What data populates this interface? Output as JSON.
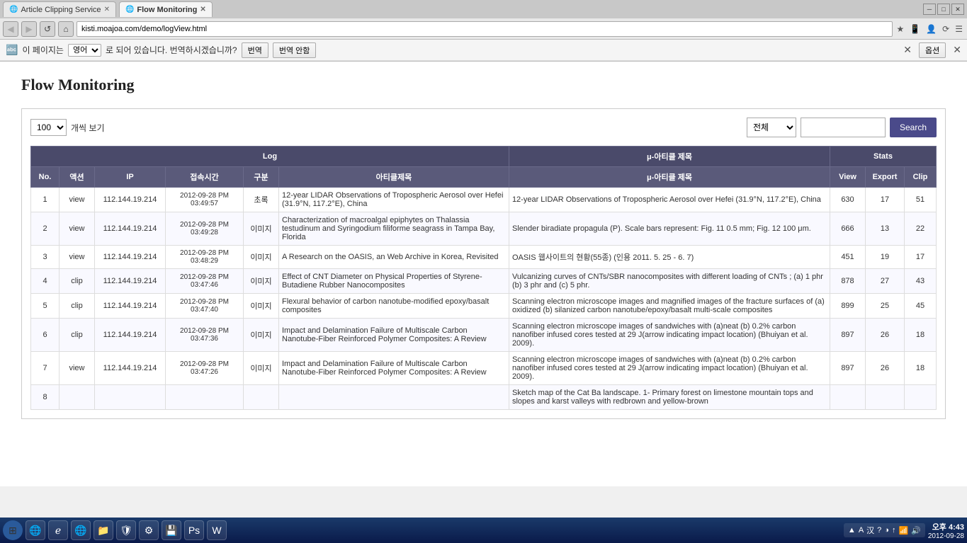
{
  "browser": {
    "tabs": [
      {
        "label": "Article Clipping Service",
        "active": false,
        "icon": "🌐"
      },
      {
        "label": "Flow Monitoring",
        "active": true,
        "icon": "🌐"
      }
    ],
    "url": "kisti.moajoa.com/demo/logView.html",
    "window_controls": [
      "─",
      "□",
      "✕"
    ]
  },
  "translate_bar": {
    "icon": "A",
    "text1": "이 페이지는",
    "lang_select": "영어",
    "text2": "로 되어 있습니다. 번역하시겠습니까?",
    "btn_translate": "번역",
    "btn_no_translate": "번역 안함",
    "btn_options": "옵션",
    "close": "✕"
  },
  "page": {
    "title": "Flow Monitoring"
  },
  "toolbar": {
    "per_page": "100",
    "per_page_label": "개씩 보기",
    "filter_option": "전체",
    "search_placeholder": "",
    "search_btn": "Search"
  },
  "table": {
    "section_log": "Log",
    "section_stats": "Stats",
    "headers": [
      "No.",
      "액션",
      "IP",
      "접속시간",
      "구분",
      "아티클제목",
      "μ-아티클 제목",
      "View",
      "Export",
      "Clip"
    ],
    "rows": [
      {
        "no": "1",
        "action": "view",
        "ip": "112.144.19.214",
        "time": "2012-09-28 PM\n03:49:57",
        "type": "초록",
        "article": "12-year LIDAR Observations of Tropospheric Aerosol over Hefei (31.9°N, 117.2°E), China",
        "micro": "12-year LIDAR Observations of Tropospheric Aerosol over Hefei (31.9°N, 117.2°E), China",
        "view": "630",
        "export": "17",
        "clip": "51"
      },
      {
        "no": "2",
        "action": "view",
        "ip": "112.144.19.214",
        "time": "2012-09-28 PM\n03:49:28",
        "type": "이미지",
        "article": "Characterization of macroalgal epiphytes on Thalassia testudinum and Syringodium filiforme seagrass in Tampa Bay, Florida",
        "micro": "Slender biradiate propagula (P). Scale bars represent: Fig. 11 0.5 mm; Fig. 12 100 μm.",
        "view": "666",
        "export": "13",
        "clip": "22"
      },
      {
        "no": "3",
        "action": "view",
        "ip": "112.144.19.214",
        "time": "2012-09-28 PM\n03:48:29",
        "type": "이미지",
        "article": "A Research on the OASIS, an Web Archive in Korea, Revisited",
        "micro": "OASIS 웹사이트의 현황(55종) (인용 2011. 5. 25 - 6. 7)",
        "view": "451",
        "export": "19",
        "clip": "17"
      },
      {
        "no": "4",
        "action": "clip",
        "ip": "112.144.19.214",
        "time": "2012-09-28 PM\n03:47:46",
        "type": "이미지",
        "article": "Effect of CNT Diameter on Physical Properties of Styrene-Butadiene Rubber Nanocomposites",
        "micro": "Vulcanizing curves of CNTs/SBR nanocomposites with different loading of CNTs ; (a) 1 phr (b) 3 phr and (c) 5 phr.",
        "view": "878",
        "export": "27",
        "clip": "43"
      },
      {
        "no": "5",
        "action": "clip",
        "ip": "112.144.19.214",
        "time": "2012-09-28 PM\n03:47:40",
        "type": "이미지",
        "article": "Flexural behavior of carbon nanotube-modified epoxy/basalt composites",
        "micro": "Scanning electron microscope images and magnified images of the fracture surfaces of (a) oxidized (b) silanized carbon nanotube/epoxy/basalt multi-scale composites",
        "view": "899",
        "export": "25",
        "clip": "45"
      },
      {
        "no": "6",
        "action": "clip",
        "ip": "112.144.19.214",
        "time": "2012-09-28 PM\n03:47:36",
        "type": "이미지",
        "article": "Impact and Delamination Failure of Multiscale Carbon Nanotube-Fiber Reinforced Polymer Composites: A Review",
        "micro": "Scanning electron microscope images of sandwiches with (a)neat (b) 0.2% carbon nanofiber infused cores tested at 29 J(arrow indicating impact location) (Bhuiyan et al. 2009).",
        "view": "897",
        "export": "26",
        "clip": "18"
      },
      {
        "no": "7",
        "action": "view",
        "ip": "112.144.19.214",
        "time": "2012-09-28 PM\n03:47:26",
        "type": "이미지",
        "article": "Impact and Delamination Failure of Multiscale Carbon Nanotube-Fiber Reinforced Polymer Composites: A Review",
        "micro": "Scanning electron microscope images of sandwiches with (a)neat (b) 0.2% carbon nanofiber infused cores tested at 29 J(arrow indicating impact location) (Bhuiyan et al. 2009).",
        "view": "897",
        "export": "26",
        "clip": "18"
      },
      {
        "no": "8",
        "action": "",
        "ip": "",
        "time": "",
        "type": "",
        "article": "",
        "micro": "Sketch map of the Cat Ba landscape. 1- Primary forest on limestone mountain tops and slopes and karst valleys with redbrown and yellow-brown",
        "view": "",
        "export": "",
        "clip": ""
      }
    ]
  },
  "taskbar": {
    "start_icon": "⊞",
    "app_icons": [
      "🌐",
      "⚙",
      "📁",
      "🛡",
      "🔧",
      "💾",
      "🖼",
      "📄"
    ],
    "tray_items": [
      "A",
      "汉",
      "?",
      "◑"
    ],
    "clock_time": "오후 4:43",
    "clock_date": "2012-09-28"
  }
}
